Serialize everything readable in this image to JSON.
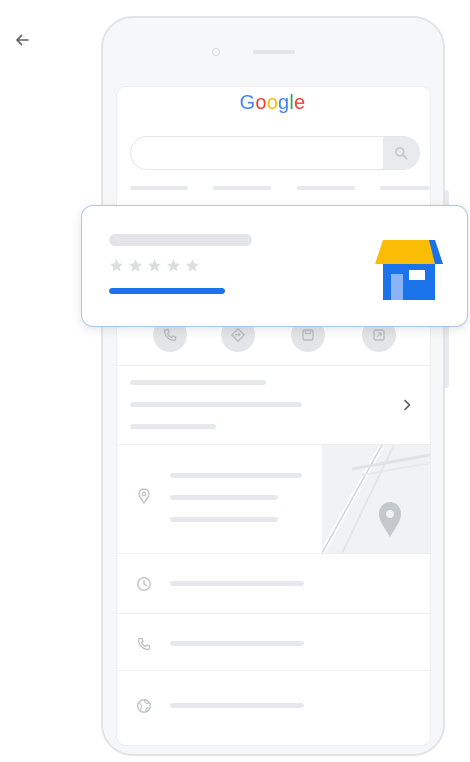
{
  "header": {
    "back_icon": "arrow-left-icon"
  },
  "search": {
    "logo_letters": [
      {
        "char": "G",
        "color": "#4285f4"
      },
      {
        "char": "o",
        "color": "#ea4335"
      },
      {
        "char": "o",
        "color": "#fbbc05"
      },
      {
        "char": "g",
        "color": "#4285f4"
      },
      {
        "char": "l",
        "color": "#34a853"
      },
      {
        "char": "e",
        "color": "#ea4335"
      }
    ],
    "search_icon": "search-icon"
  },
  "actions": {
    "icons": [
      "phone-icon",
      "directions-icon",
      "save-icon",
      "share-icon"
    ]
  },
  "rows": {
    "icons": [
      "location-pin-icon",
      "clock-icon",
      "phone-icon",
      "globe-icon"
    ],
    "chevron_icon": "chevron-right-icon"
  },
  "card": {
    "rating_stars": 5,
    "store_icon": "storefront-icon",
    "colors": {
      "accent": "#1a73e8",
      "store_roof": "#fbbc05",
      "store_body": "#1a73e8",
      "border": "#a9c7ec"
    }
  }
}
